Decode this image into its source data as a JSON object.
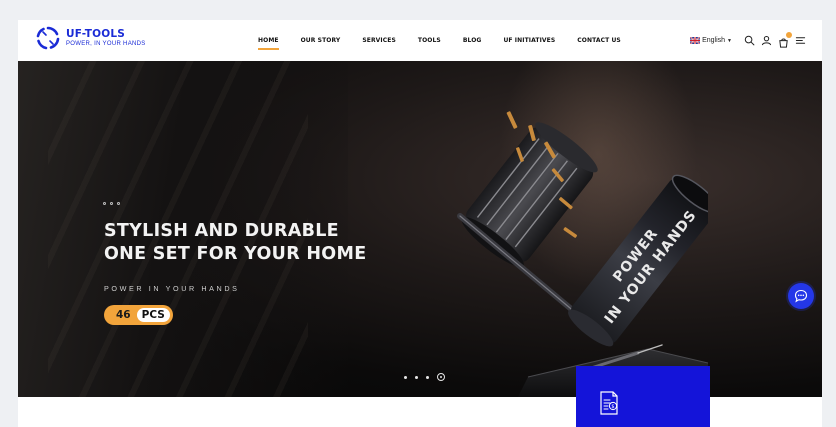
{
  "brand": {
    "name": "UF-TOOLS",
    "tagline": "POWER, IN YOUR HANDS",
    "color": "#1a2bd6"
  },
  "nav": {
    "items": [
      {
        "label": "HOME",
        "active": true
      },
      {
        "label": "OUR STORY"
      },
      {
        "label": "SERVICES"
      },
      {
        "label": "TOOLS"
      },
      {
        "label": "BLOG"
      },
      {
        "label": "UF INITIATIVES"
      },
      {
        "label": "CONTACT US"
      }
    ],
    "accent": "#f2a43b"
  },
  "header_tools": {
    "language": "English",
    "icons": [
      "uk-flag-icon",
      "search-icon",
      "user-icon",
      "cart-icon",
      "menu-icon"
    ]
  },
  "hero": {
    "headline_line1": "STYLISH AND DURABLE",
    "headline_line2": "ONE SET FOR YOUR HOME",
    "subline": "POWER IN YOUR HANDS",
    "pcs_number": "46",
    "pcs_label": "PCS",
    "product_text": "POWER IN YOUR HANDS",
    "slides": 4,
    "active_slide": 4
  },
  "widgets": {
    "chat": "chat-bubble-icon",
    "card_icon": "document-money-icon",
    "card_color": "#1414d9"
  }
}
